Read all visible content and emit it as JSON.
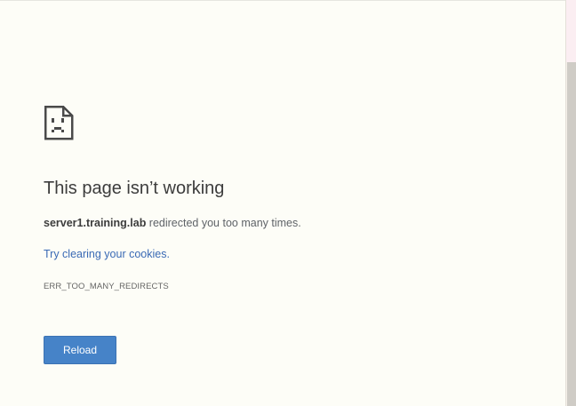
{
  "page": {
    "icon": "sad-page-icon",
    "title": "This page isn’t working",
    "summary_host": "server1.training.lab",
    "summary_rest": " redirected you too many times.",
    "suggestion_link": "Try clearing your cookies.",
    "error_code": "ERR_TOO_MANY_REDIRECTS",
    "reload_label": "Reload"
  },
  "colors": {
    "background": "#fdfdf7",
    "title_text": "#3c3c3c",
    "body_text": "#5f6368",
    "link": "#3a6ab5",
    "button": "#4683c8",
    "button_text": "#ffffff"
  }
}
